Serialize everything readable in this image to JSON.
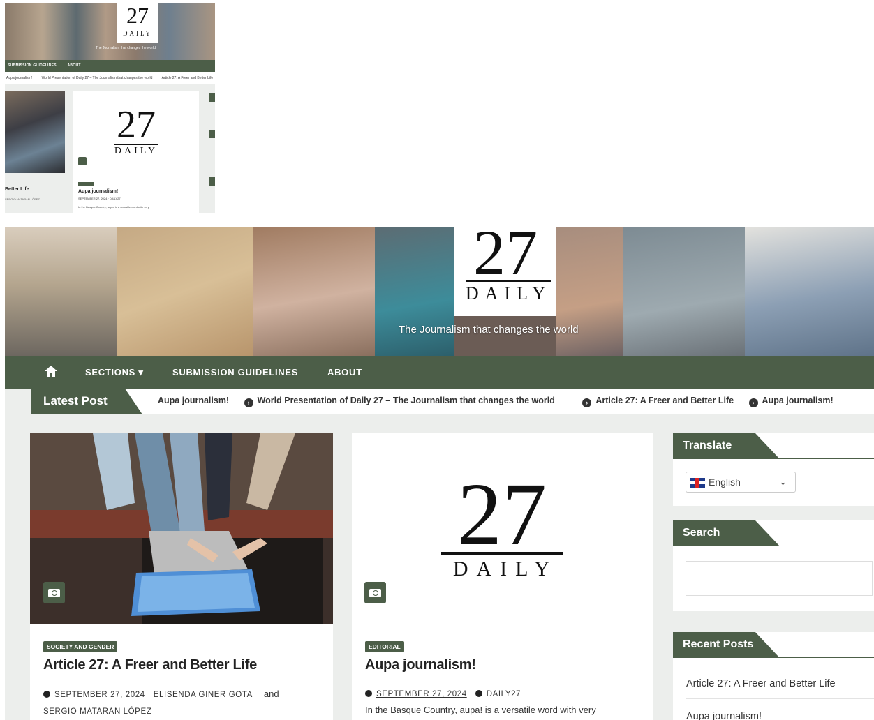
{
  "thumbnail": {
    "logo_number": "27",
    "logo_word": "DAILY",
    "tagline": "The Journalism that changes the world",
    "nav": [
      "SUBMISSION GUIDELINES",
      "ABOUT"
    ],
    "ticker": [
      "Aupa journalism!",
      "World Presentation of Daily 27 – The Journalism that changes the world",
      "Article 27: A Freer and Better Life"
    ],
    "card_title": "Aupa journalism!",
    "card_meta": "SEPTEMBER 27, 2024 · DAILY27",
    "card_excerpt": "In the Basque Country, aupa! is a versatile word with very",
    "left_title": "Better Life",
    "left_meta": "SERGIO MATARAN LÓPEZ"
  },
  "header": {
    "logo_number": "27",
    "logo_word": "DAILY",
    "tagline": "The Journalism that changes the world"
  },
  "nav": {
    "home_icon": "home-icon",
    "items": [
      "SECTIONS ▾",
      "SUBMISSION GUIDELINES",
      "ABOUT"
    ]
  },
  "ticker": {
    "label": "Latest Post",
    "items": [
      "Aupa journalism!",
      "World Presentation of Daily 27 – The Journalism that changes the world",
      "Article 27: A Freer and Better Life",
      "Aupa journalism!"
    ]
  },
  "posts": [
    {
      "category": "SOCIETY AND GENDER",
      "title": "Article 27: A Freer and Better Life",
      "date": "SEPTEMBER 27, 2024",
      "author1": "ELISENDA GINER GOTA",
      "and": "and",
      "author2": "SERGIO MATARAN LÓPEZ"
    },
    {
      "category": "EDITORIAL",
      "title": "Aupa journalism!",
      "date": "SEPTEMBER 27, 2024",
      "author1": "DAILY27",
      "excerpt": "In the Basque Country, aupa! is a versatile word with very",
      "logo_number": "27",
      "logo_word": "DAILY"
    }
  ],
  "sidebar": {
    "translate_title": "Translate",
    "language": "English",
    "search_title": "Search",
    "recent_title": "Recent Posts",
    "recent": [
      "Article 27: A Freer and Better Life",
      "Aupa journalism!"
    ]
  },
  "colors": {
    "brand_green": "#4c5e48",
    "page_bg": "#eceeec"
  }
}
